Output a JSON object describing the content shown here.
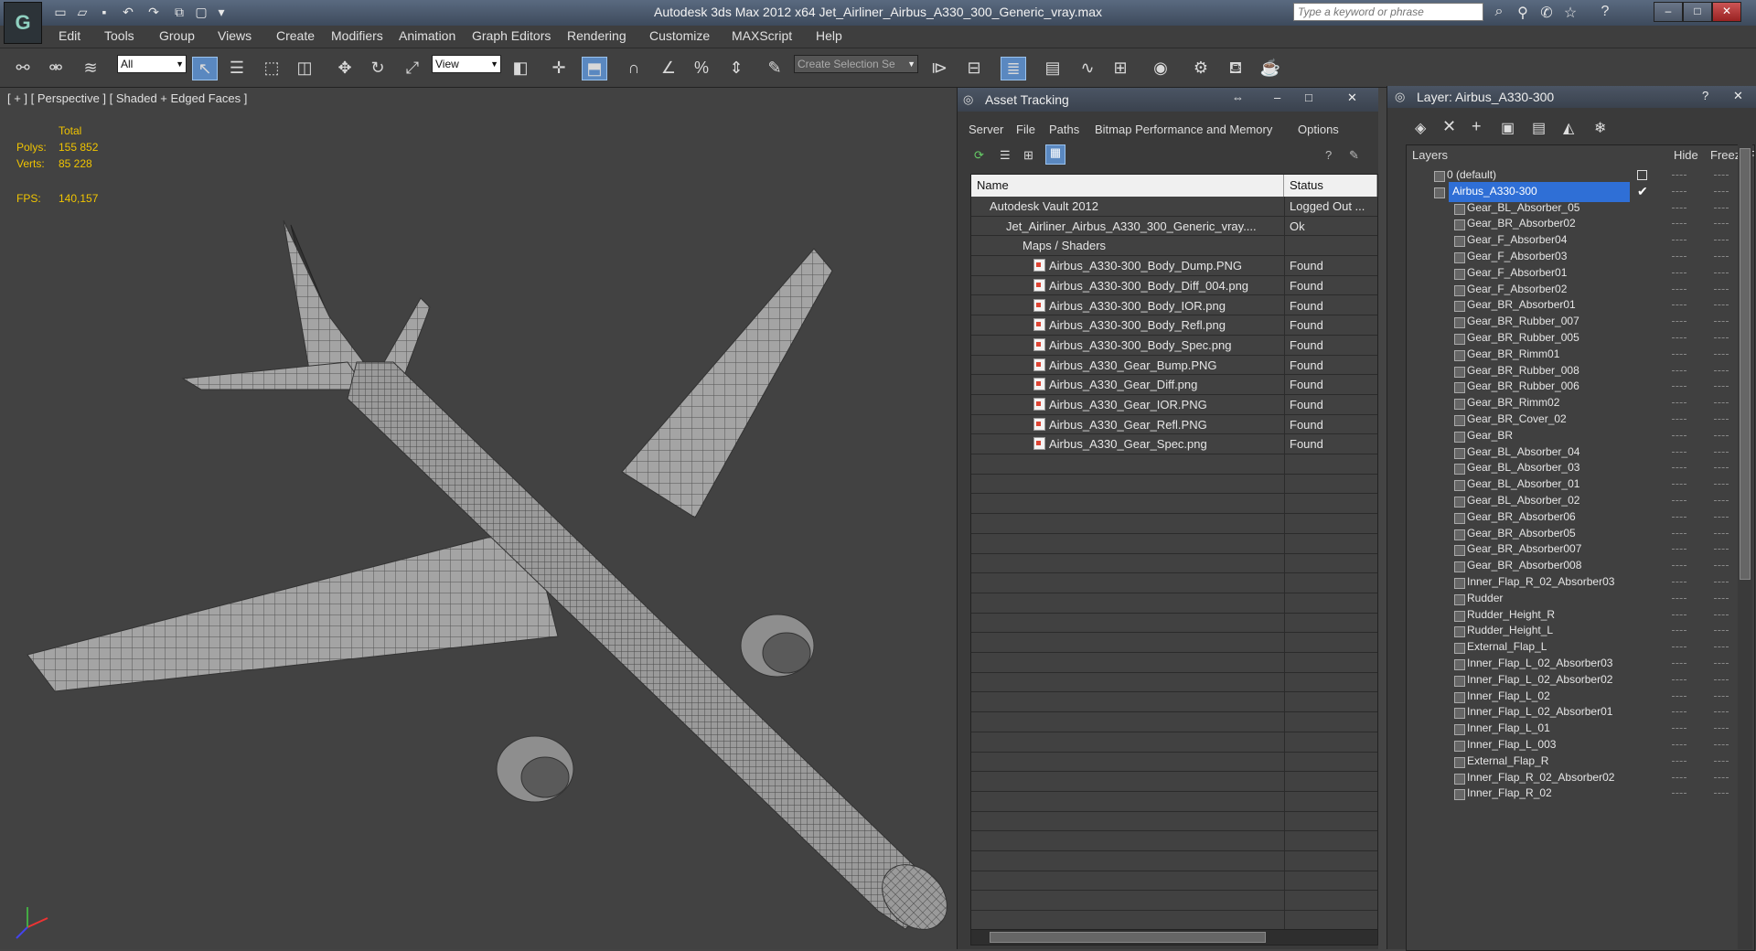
{
  "window": {
    "title": "Autodesk 3ds Max  2012 x64      Jet_Airliner_Airbus_A330_300_Generic_vray.max",
    "search_placeholder": "Type a keyword or phrase",
    "app_logo": "G"
  },
  "menu": [
    "Edit",
    "Tools",
    "Group",
    "Views",
    "Create",
    "Modifiers",
    "Animation",
    "Graph Editors",
    "Rendering",
    "Customize",
    "MAXScript",
    "Help"
  ],
  "toolbar": {
    "selection_filter": "All",
    "reference_coord": "View",
    "named_selection": "Create Selection Se"
  },
  "viewport": {
    "label": "[ + ] [ Perspective ] [ Shaded + Edged Faces ]",
    "stats_header": "Total",
    "polys_label": "Polys:",
    "polys_value": "155 852",
    "verts_label": "Verts:",
    "verts_value": "85 228",
    "fps_label": "FPS:",
    "fps_value": "140,157"
  },
  "asset_tracking": {
    "title": "Asset Tracking",
    "menus": [
      "Server",
      "File",
      "Paths",
      "Bitmap Performance and Memory",
      "Options"
    ],
    "col_name": "Name",
    "col_status": "Status",
    "rows": [
      {
        "name": "Autodesk Vault 2012",
        "status": "Logged Out ...",
        "level": 0
      },
      {
        "name": "Jet_Airliner_Airbus_A330_300_Generic_vray....",
        "status": "Ok",
        "level": 1
      },
      {
        "name": "Maps / Shaders",
        "status": "",
        "level": 2
      },
      {
        "name": "Airbus_A330-300_Body_Dump.PNG",
        "status": "Found",
        "level": 3
      },
      {
        "name": "Airbus_A330-300_Body_Diff_004.png",
        "status": "Found",
        "level": 3
      },
      {
        "name": "Airbus_A330-300_Body_IOR.png",
        "status": "Found",
        "level": 3
      },
      {
        "name": "Airbus_A330-300_Body_Refl.png",
        "status": "Found",
        "level": 3
      },
      {
        "name": "Airbus_A330-300_Body_Spec.png",
        "status": "Found",
        "level": 3
      },
      {
        "name": "Airbus_A330_Gear_Bump.PNG",
        "status": "Found",
        "level": 3
      },
      {
        "name": "Airbus_A330_Gear_Diff.png",
        "status": "Found",
        "level": 3
      },
      {
        "name": "Airbus_A330_Gear_IOR.PNG",
        "status": "Found",
        "level": 3
      },
      {
        "name": "Airbus_A330_Gear_Refl.PNG",
        "status": "Found",
        "level": 3
      },
      {
        "name": "Airbus_A330_Gear_Spec.png",
        "status": "Found",
        "level": 3
      }
    ]
  },
  "layer_panel": {
    "title": "Layer: Airbus_A330-300",
    "col_layers": "Layers",
    "col_hide": "Hide",
    "col_freeze": "Freeze",
    "col_more": "F",
    "rows": [
      "0 (default)",
      "Airbus_A330-300",
      "Gear_BL_Absorber_05",
      "Gear_BR_Absorber02",
      "Gear_F_Absorber04",
      "Gear_F_Absorber03",
      "Gear_F_Absorber01",
      "Gear_F_Absorber02",
      "Gear_BR_Absorber01",
      "Gear_BR_Rubber_007",
      "Gear_BR_Rubber_005",
      "Gear_BR_Rimm01",
      "Gear_BR_Rubber_008",
      "Gear_BR_Rubber_006",
      "Gear_BR_Rimm02",
      "Gear_BR_Cover_02",
      "Gear_BR",
      "Gear_BL_Absorber_04",
      "Gear_BL_Absorber_03",
      "Gear_BL_Absorber_01",
      "Gear_BL_Absorber_02",
      "Gear_BR_Absorber06",
      "Gear_BR_Absorber05",
      "Gear_BR_Absorber007",
      "Gear_BR_Absorber008",
      "Inner_Flap_R_02_Absorber03",
      "Rudder",
      "Rudder_Height_R",
      "Rudder_Height_L",
      "External_Flap_L",
      "Inner_Flap_L_02_Absorber03",
      "Inner_Flap_L_02_Absorber02",
      "Inner_Flap_L_02",
      "Inner_Flap_L_02_Absorber01",
      "Inner_Flap_L_01",
      "Inner_Flap_L_003",
      "External_Flap_R",
      "Inner_Flap_R_02_Absorber02",
      "Inner_Flap_R_02"
    ]
  },
  "colors": {
    "selection": "#2f6fd6",
    "stats": "#f0c400",
    "active_tool": "#5a88c0"
  }
}
